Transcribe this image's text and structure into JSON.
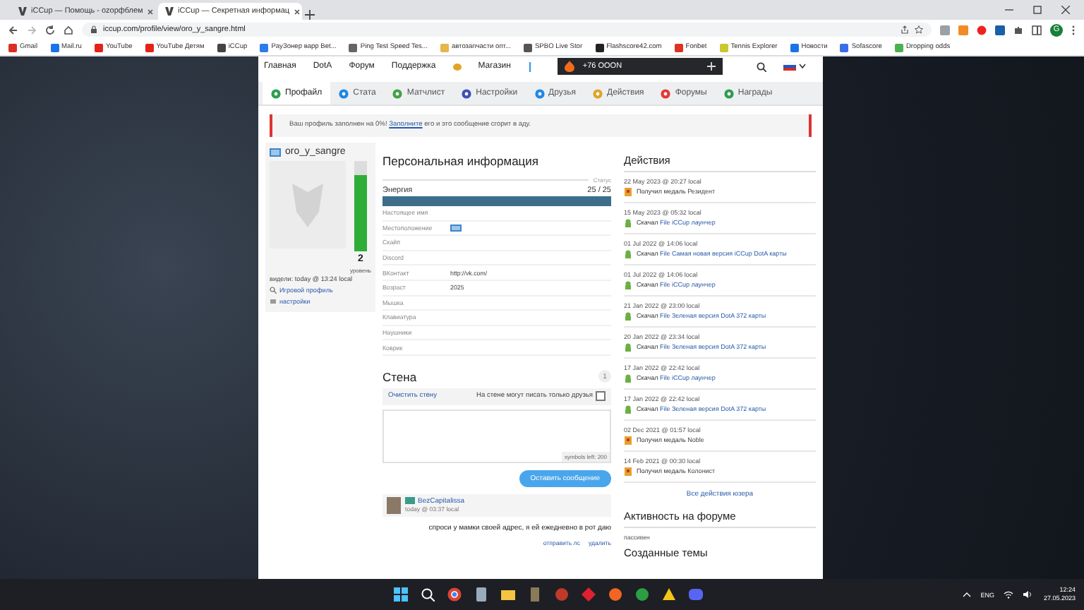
{
  "browser": {
    "tabs": [
      {
        "title": "iCCup — Помощь - ozорфблем",
        "selected": false
      },
      {
        "title": "iCCup — Секретная информац",
        "selected": true
      }
    ],
    "url": "iccup.com/profile/view/oro_y_sangre.html",
    "profile_initial": "G",
    "bookmarks": [
      "Gmail",
      "Mail.ru",
      "YouTube",
      "YouTube Детям",
      "iCCup",
      "PayЗонер варp Bet...",
      "Ping Test Speed Tes...",
      "автозапчасти опт...",
      "SPBO Live Stor",
      "Flashscore42.com",
      "Fonbet",
      "Tennis Explorer",
      "Новости",
      "Sofascore",
      "Dropping odds"
    ]
  },
  "site": {
    "nav": [
      "Главная",
      "DotA",
      "Форум",
      "Поддержка",
      "Магазин"
    ],
    "banner": "+76 OOON",
    "profile_tabs": [
      {
        "label": "Профайл",
        "selected": true
      },
      {
        "label": "Стата",
        "selected": false
      },
      {
        "label": "Матчлист",
        "selected": false
      },
      {
        "label": "Настройки",
        "selected": false
      },
      {
        "label": "Друзья",
        "selected": false
      },
      {
        "label": "Действия",
        "selected": false
      },
      {
        "label": "Форумы",
        "selected": false
      },
      {
        "label": "Награды",
        "selected": false
      }
    ],
    "notice": {
      "before": "Ваш профиль заполнен на 0%!",
      "link": "Заполните",
      "after": "его и это сообщение сгорит в аду."
    }
  },
  "profile": {
    "username": "oro_y_sangre",
    "energy": {
      "level": 0.85
    },
    "level_number": "2",
    "level_label": "уровень",
    "seen": "видели: today @ 13:24 local",
    "links": [
      "Игровой профиль",
      "настройки"
    ]
  },
  "info": {
    "title": "Персональная информация",
    "status_label": "Статус",
    "energy": {
      "label": "Энергия",
      "reading": "25 / 25",
      "level": 1
    },
    "fields": [
      {
        "label": "Настоящее имя",
        "kind": "text"
      },
      {
        "label": "Местоположение",
        "kind": "flag"
      },
      {
        "label": "Скайп",
        "kind": "text"
      },
      {
        "label": "Discord",
        "kind": "text"
      },
      {
        "label": "ВКонтакт",
        "kind": "text",
        "value": "http://vk.com/"
      },
      {
        "label": "Возраст",
        "kind": "text",
        "value": "2025"
      },
      {
        "label": "Мышка",
        "kind": "text"
      },
      {
        "label": "Клавиатура",
        "kind": "text"
      },
      {
        "label": "Наушники",
        "kind": "text"
      },
      {
        "label": "Коврик",
        "kind": "text"
      }
    ]
  },
  "wall": {
    "title": "Стена",
    "page": "1",
    "clear": "Очистить стену",
    "friends_only": {
      "label": "На стене могут писать только друзья",
      "checked": false
    },
    "counter": "symbols left: 200",
    "submit": "Оставить сообщение",
    "posts": [
      {
        "author": "BezCapitalissa",
        "time": "today @ 03:37 local",
        "text": "спроси у мамки своей адрес, я ей ежедневно в рот даю",
        "actions": [
          "отправить лс",
          "удалить"
        ]
      }
    ]
  },
  "actions": {
    "title": "Действия",
    "items": [
      {
        "date": "22 May 2023 @ 20:27 local",
        "kind": "medal",
        "verb": "Получил медаль",
        "object": "Резидент"
      },
      {
        "date": "15 May 2023 @ 05:32 local",
        "kind": "download",
        "verb": "Скачал",
        "object": "File iCCup лаунчер"
      },
      {
        "date": "01 Jul 2022 @ 14:06 local",
        "kind": "download",
        "verb": "Скачал",
        "object": "File Самая новая версия iCCup DotA карты"
      },
      {
        "date": "01 Jul 2022 @ 14:06 local",
        "kind": "download",
        "verb": "Скачал",
        "object": "File iCCup лаунчер"
      },
      {
        "date": "21 Jan 2022 @ 23:00 local",
        "kind": "download",
        "verb": "Скачал",
        "object": "File Зеленая версия DotA 372 карты"
      },
      {
        "date": "20 Jan 2022 @ 23:34 local",
        "kind": "download",
        "verb": "Скачал",
        "object": "File Зеленая версия DotA 372 карты"
      },
      {
        "date": "17 Jan 2022 @ 22:42 local",
        "kind": "download",
        "verb": "Скачал",
        "object": "File iCCup лаунчер"
      },
      {
        "date": "17 Jan 2022 @ 22:42 local",
        "kind": "download",
        "verb": "Скачал",
        "object": "File Зеленая версия DotA 372 карты"
      },
      {
        "date": "02 Dec 2021 @ 01:57 local",
        "kind": "medal",
        "verb": "Получил медаль",
        "object": "Noble"
      },
      {
        "date": "14 Feb 2021 @ 00:30 local",
        "kind": "medal",
        "verb": "Получил медаль",
        "object": "Колонист"
      }
    ],
    "all_link": "Все действия юзера"
  },
  "forum": {
    "title": "Активность на форуме",
    "status": "пассивен",
    "topics_title": "Созданные темы"
  },
  "taskbar": {
    "language": "ENG",
    "time": "12:24",
    "date": "27.05.2023"
  }
}
